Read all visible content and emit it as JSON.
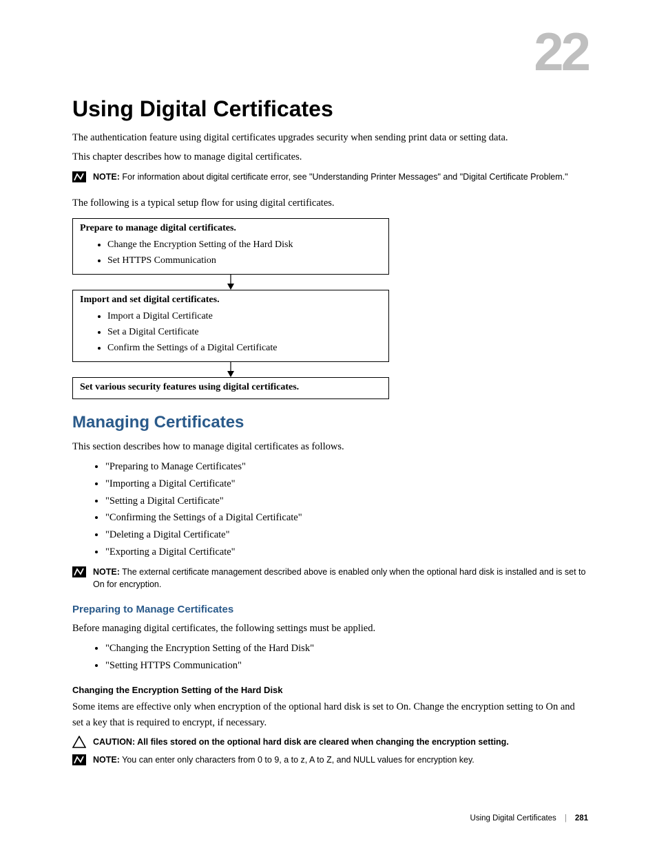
{
  "chapter_number": "22",
  "title": "Using Digital Certificates",
  "intro_p1": "The authentication feature using digital certificates upgrades security when sending print data or setting data.",
  "intro_p2": "This chapter describes how to manage digital certificates.",
  "note1": {
    "label": "NOTE:",
    "text": " For information about digital certificate error, see \"Understanding Printer Messages\" and \"Digital Certificate Problem.\""
  },
  "flow_intro": "The following is a typical setup flow for using digital certificates.",
  "flow": {
    "box1": {
      "title": "Prepare to manage digital certificates.",
      "items": [
        "Change the Encryption Setting of the Hard Disk",
        "Set HTTPS Communication"
      ]
    },
    "box2": {
      "title": "Import and set digital certificates.",
      "items": [
        "Import a Digital Certificate",
        "Set a Digital Certificate",
        "Confirm the Settings of a Digital Certificate"
      ]
    },
    "box3": {
      "title": "Set various security features using digital certificates."
    }
  },
  "section": {
    "heading": "Managing Certificates",
    "intro": "This section describes how to manage digital certificates as follows.",
    "items": [
      "\"Preparing to Manage Certificates\"",
      "\"Importing a Digital Certificate\"",
      "\"Setting a Digital Certificate\"",
      "\"Confirming the Settings of a Digital Certificate\"",
      "\"Deleting a Digital Certificate\"",
      "\"Exporting a Digital Certificate\""
    ],
    "note": {
      "label": "NOTE:",
      "text": " The external certificate management described above is enabled only when the optional hard disk is installed and is set to On for encryption."
    }
  },
  "sub1": {
    "heading": "Preparing to Manage Certificates",
    "intro": "Before managing digital certificates, the following settings must be applied.",
    "items": [
      "\"Changing the Encryption Setting of the Hard Disk\"",
      "\"Setting HTTPS Communication\""
    ]
  },
  "sub2": {
    "heading": "Changing the Encryption Setting of the Hard Disk",
    "body": "Some items are effective only when encryption of the optional hard disk is set to On. Change the encryption setting to On and set a key that is required to encrypt, if necessary.",
    "caution": {
      "label": "CAUTION:",
      "text": " All files stored on the optional hard disk are cleared when changing the encryption setting."
    },
    "note": {
      "label": "NOTE:",
      "text": " You can enter only characters from 0 to 9, a to z, A to Z, and NULL values for encryption key."
    }
  },
  "footer": {
    "title": "Using Digital Certificates",
    "page": "281"
  }
}
